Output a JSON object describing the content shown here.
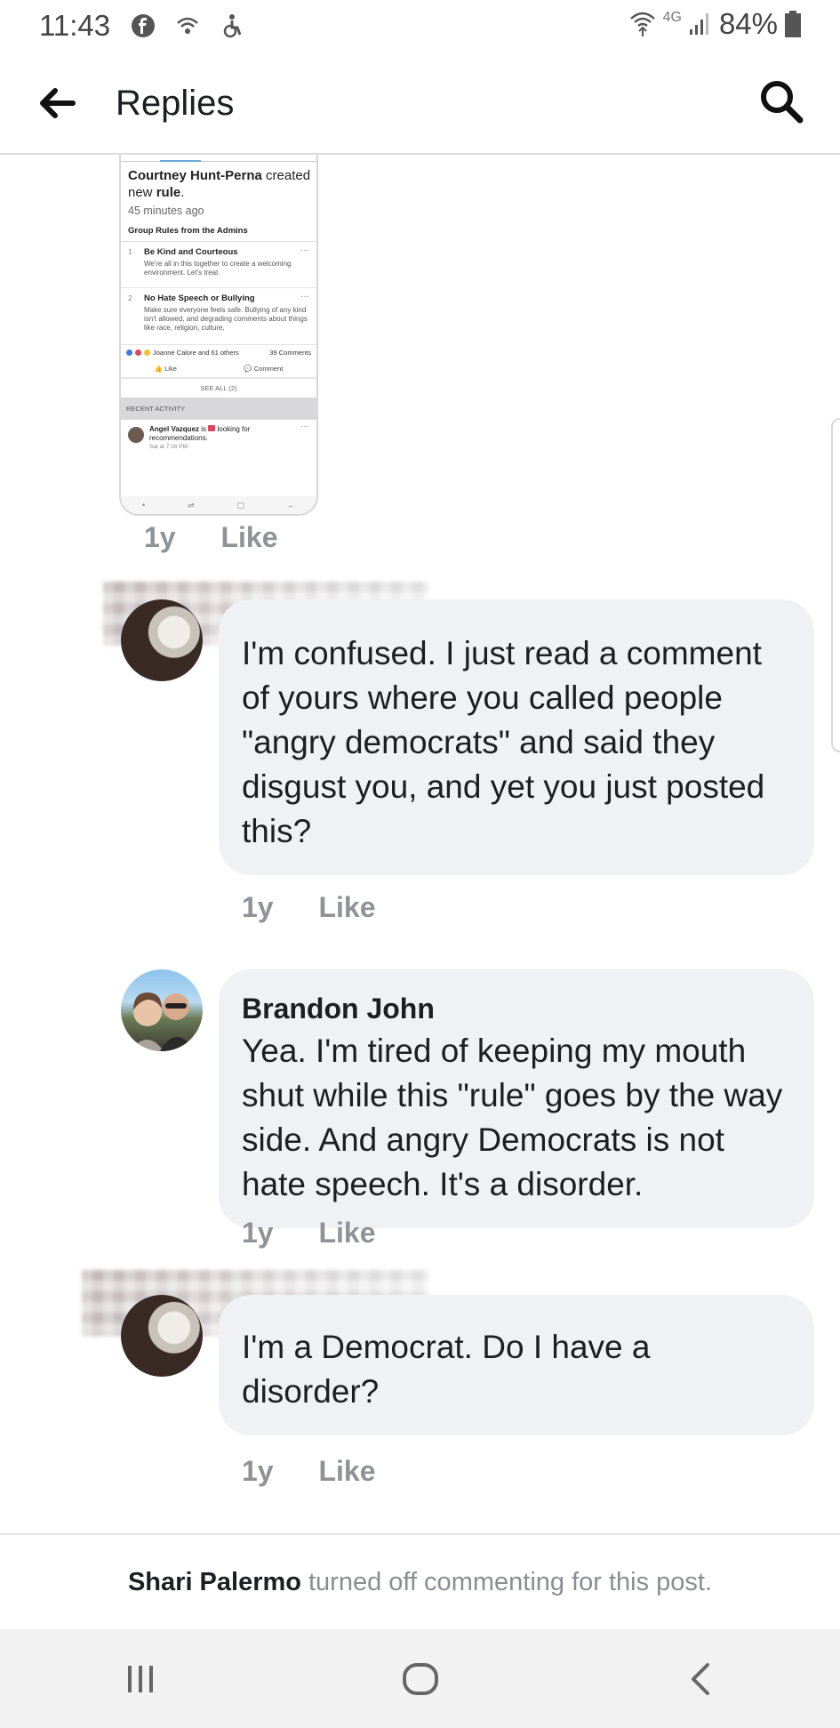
{
  "status_bar": {
    "time": "11:43",
    "network": "4G",
    "battery": "84%",
    "icons": [
      "facebook-icon",
      "wifi-calling-icon",
      "accessibility-icon",
      "wifi-icon",
      "signal-icon",
      "battery-icon"
    ]
  },
  "app_bar": {
    "title": "Replies",
    "back_icon": "back-arrow-icon",
    "search_icon": "search-icon"
  },
  "embedded_post": {
    "author": "Courtney Hunt-Perna",
    "action": " created",
    "action_tail": "new",
    "action_obj": "rule",
    "time": "45 minutes ago",
    "rules_header": "Group Rules from the Admins",
    "rules": [
      {
        "num": "1",
        "title": "Be Kind and Courteous",
        "desc": "We're all in this together to create a welcoming environment. Let's treat"
      },
      {
        "num": "2",
        "title": "No Hate Speech or Bullying",
        "desc": "Make sure everyone feels safe. Bullying of any kind isn't allowed, and degrading comments about things like race, religion, culture,"
      }
    ],
    "reactions_text": "Joanne Calore and 61 others",
    "comments_count": "39 Comments",
    "like_label": "Like",
    "comment_label": "Comment",
    "see_all": "SEE ALL (2)",
    "recent_header": "RECENT ACTIVITY",
    "activity_name": "Angel Vazquez",
    "activity_text": " is ",
    "activity_tail": "looking for recommendations.",
    "activity_time": "Sat at 7:16 PM ·"
  },
  "embed_meta": {
    "time": "1y",
    "like": "Like"
  },
  "comments": [
    {
      "author": "",
      "text": "I'm confused. I just read a comment of yours where you called people \"angry democrats\" and said they disgust you, and yet you just posted this?",
      "time": "1y",
      "like": "Like"
    },
    {
      "author": "Brandon John",
      "text": "Yea. I'm tired of keeping my mouth shut while this \"rule\" goes by the way side. And angry Democrats is not hate speech. It's a disorder.",
      "time": "1y",
      "like": "Like"
    },
    {
      "author": "",
      "text": "I'm a Democrat. Do I have a disorder?",
      "time": "1y",
      "like": "Like"
    }
  ],
  "footer": {
    "name": "Shari Palermo",
    "message": "turned off commenting for this post."
  },
  "system_nav": {
    "recents": "recents-icon",
    "home": "home-icon",
    "back": "back-chevron-icon"
  }
}
